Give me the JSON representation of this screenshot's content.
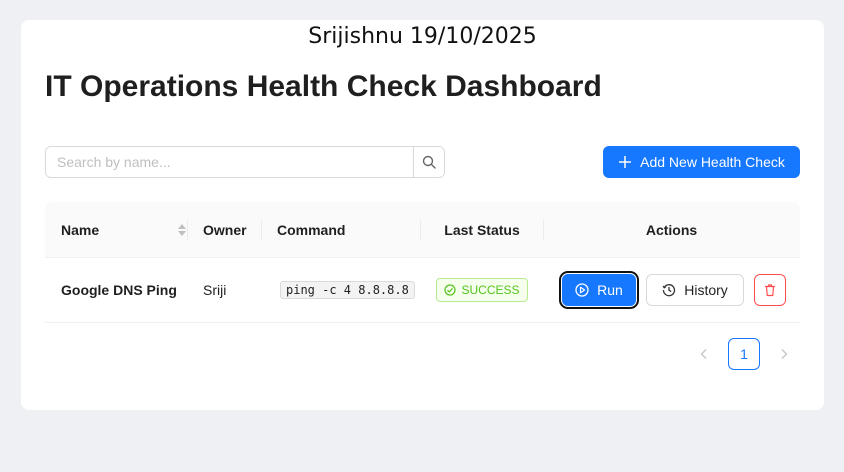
{
  "watermark": "Srijishnu 19/10/2025",
  "page_title": "IT Operations Health Check Dashboard",
  "search": {
    "placeholder": "Search by name..."
  },
  "add_button": {
    "label": "Add New Health Check"
  },
  "table": {
    "columns": [
      "Name",
      "Owner",
      "Command",
      "Last Status",
      "Actions"
    ],
    "rows": [
      {
        "name": "Google DNS Ping",
        "owner": "Sriji",
        "command": "ping -c 4 8.8.8.8",
        "status": "SUCCESS"
      }
    ]
  },
  "actions": {
    "run": "Run",
    "history": "History"
  },
  "pagination": {
    "current_page": "1"
  },
  "colors": {
    "primary": "#1677ff",
    "success": "#52c41a",
    "danger": "#ff4d4f"
  },
  "icons": [
    "search-icon",
    "plus-icon",
    "sort-icon",
    "check-circle-icon",
    "play-circle-icon",
    "history-icon",
    "trash-icon",
    "chevron-left-icon",
    "chevron-right-icon"
  ]
}
